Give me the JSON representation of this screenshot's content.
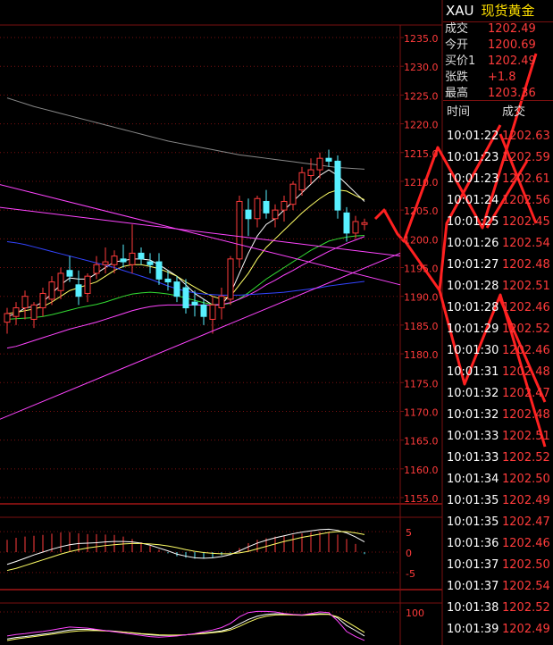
{
  "header": {
    "symbol": "XAU",
    "name": "现货黄金"
  },
  "quote": [
    {
      "label": "成交",
      "value": "1202.49"
    },
    {
      "label": "今开",
      "value": "1200.69"
    },
    {
      "label": "买价1",
      "value": "1202.49"
    },
    {
      "label": "张跌",
      "value": "+1.8"
    },
    {
      "label": "最高",
      "value": "1203.36"
    }
  ],
  "ticks_header": {
    "time": "时间",
    "price": "成交"
  },
  "ticks": [
    {
      "time": "10:01:22",
      "price": "1202.63"
    },
    {
      "time": "10:01:23",
      "price": "1202.59"
    },
    {
      "time": "10:01:23",
      "price": "1202.61"
    },
    {
      "time": "10:01:24",
      "price": "1202.56"
    },
    {
      "time": "10:01:25",
      "price": "1202.45"
    },
    {
      "time": "10:01:26",
      "price": "1202.54"
    },
    {
      "time": "10:01:27",
      "price": "1202.48"
    },
    {
      "time": "10:01:28",
      "price": "1202.51"
    },
    {
      "time": "10:01:28",
      "price": "1202.46"
    },
    {
      "time": "10:01:29",
      "price": "1202.52"
    },
    {
      "time": "10:01:30",
      "price": "1202.46"
    },
    {
      "time": "10:01:31",
      "price": "1202.48"
    },
    {
      "time": "10:01:32",
      "price": "1202.47"
    },
    {
      "time": "10:01:32",
      "price": "1202.48"
    },
    {
      "time": "10:01:33",
      "price": "1202.51"
    },
    {
      "time": "10:01:33",
      "price": "1202.52"
    },
    {
      "time": "10:01:34",
      "price": "1202.50"
    },
    {
      "time": "10:01:35",
      "price": "1202.49"
    },
    {
      "time": "10:01:35",
      "price": "1202.47"
    },
    {
      "time": "10:01:36",
      "price": "1202.46"
    },
    {
      "time": "10:01:37",
      "price": "1202.50"
    },
    {
      "time": "10:01:37",
      "price": "1202.54"
    },
    {
      "time": "10:01:38",
      "price": "1202.52"
    },
    {
      "time": "10:01:39",
      "price": "1202.49"
    }
  ],
  "colors": {
    "up": "#ff3b3b",
    "down": "#58f0ff",
    "grid": "#7a1010",
    "axis_text": "#ff3b3b"
  },
  "chart_data": [
    {
      "type": "candlestick",
      "ylim": [
        1155,
        1235
      ],
      "yticks": [
        "1235.0",
        "1230.0",
        "1225.0",
        "1220.0",
        "1215.0",
        "1210.0",
        "1205.0",
        "1200.0",
        "1195.0",
        "1190.0",
        "1185.0",
        "1180.0",
        "1175.0",
        "1170.0",
        "1165.0",
        "1160.0",
        "1155.0"
      ],
      "candles": [
        {
          "o": 1185.5,
          "h": 1188.0,
          "l": 1183.5,
          "c": 1187.0
        },
        {
          "o": 1186.5,
          "h": 1189.0,
          "l": 1185.0,
          "c": 1188.0
        },
        {
          "o": 1188.0,
          "h": 1191.0,
          "l": 1186.0,
          "c": 1190.0
        },
        {
          "o": 1186.0,
          "h": 1189.0,
          "l": 1184.5,
          "c": 1188.5
        },
        {
          "o": 1188.0,
          "h": 1191.5,
          "l": 1186.5,
          "c": 1190.5
        },
        {
          "o": 1189.5,
          "h": 1193.5,
          "l": 1188.5,
          "c": 1192.5
        },
        {
          "o": 1191.0,
          "h": 1195.0,
          "l": 1189.5,
          "c": 1194.0
        },
        {
          "o": 1194.5,
          "h": 1197.0,
          "l": 1192.5,
          "c": 1193.5
        },
        {
          "o": 1192.0,
          "h": 1194.5,
          "l": 1188.5,
          "c": 1190.0
        },
        {
          "o": 1190.5,
          "h": 1194.0,
          "l": 1189.0,
          "c": 1193.5
        },
        {
          "o": 1194.0,
          "h": 1197.0,
          "l": 1193.0,
          "c": 1195.5
        },
        {
          "o": 1195.5,
          "h": 1198.5,
          "l": 1194.0,
          "c": 1196.0
        },
        {
          "o": 1195.5,
          "h": 1198.0,
          "l": 1194.0,
          "c": 1197.0
        },
        {
          "o": 1196.5,
          "h": 1199.0,
          "l": 1195.0,
          "c": 1196.0
        },
        {
          "o": 1195.5,
          "h": 1202.5,
          "l": 1194.0,
          "c": 1197.5
        },
        {
          "o": 1197.5,
          "h": 1198.5,
          "l": 1195.5,
          "c": 1196.5
        },
        {
          "o": 1196.0,
          "h": 1197.5,
          "l": 1194.0,
          "c": 1195.5
        },
        {
          "o": 1196.0,
          "h": 1197.5,
          "l": 1192.0,
          "c": 1193.0
        },
        {
          "o": 1193.0,
          "h": 1194.5,
          "l": 1191.0,
          "c": 1192.5
        },
        {
          "o": 1192.5,
          "h": 1193.5,
          "l": 1189.0,
          "c": 1190.0
        },
        {
          "o": 1191.5,
          "h": 1193.0,
          "l": 1187.0,
          "c": 1188.0
        },
        {
          "o": 1189.0,
          "h": 1191.0,
          "l": 1186.5,
          "c": 1188.5
        },
        {
          "o": 1188.5,
          "h": 1189.5,
          "l": 1185.0,
          "c": 1186.5
        },
        {
          "o": 1186.0,
          "h": 1190.0,
          "l": 1183.5,
          "c": 1188.5
        },
        {
          "o": 1188.0,
          "h": 1191.5,
          "l": 1186.0,
          "c": 1190.0
        },
        {
          "o": 1189.5,
          "h": 1197.0,
          "l": 1188.5,
          "c": 1196.5
        },
        {
          "o": 1196.5,
          "h": 1207.5,
          "l": 1195.0,
          "c": 1206.5
        },
        {
          "o": 1205.0,
          "h": 1207.0,
          "l": 1200.5,
          "c": 1203.5
        },
        {
          "o": 1203.5,
          "h": 1207.5,
          "l": 1202.0,
          "c": 1207.0
        },
        {
          "o": 1206.5,
          "h": 1208.5,
          "l": 1203.5,
          "c": 1204.5
        },
        {
          "o": 1203.5,
          "h": 1206.0,
          "l": 1202.0,
          "c": 1205.0
        },
        {
          "o": 1205.0,
          "h": 1207.5,
          "l": 1203.0,
          "c": 1206.5
        },
        {
          "o": 1206.0,
          "h": 1210.0,
          "l": 1205.0,
          "c": 1209.5
        },
        {
          "o": 1208.5,
          "h": 1212.5,
          "l": 1207.5,
          "c": 1211.5
        },
        {
          "o": 1211.0,
          "h": 1214.0,
          "l": 1209.5,
          "c": 1212.0
        },
        {
          "o": 1212.0,
          "h": 1215.0,
          "l": 1210.5,
          "c": 1214.0
        },
        {
          "o": 1214.0,
          "h": 1215.5,
          "l": 1212.5,
          "c": 1213.5
        },
        {
          "o": 1213.5,
          "h": 1214.5,
          "l": 1203.5,
          "c": 1205.0
        },
        {
          "o": 1204.5,
          "h": 1205.5,
          "l": 1199.5,
          "c": 1201.0
        },
        {
          "o": 1201.0,
          "h": 1204.0,
          "l": 1200.0,
          "c": 1203.0
        },
        {
          "o": 1202.5,
          "h": 1203.5,
          "l": 1201.5,
          "c": 1202.8
        }
      ],
      "lines": [
        {
          "color": "#ffffff",
          "values": [
            1186.5,
            1187,
            1188,
            1188.2,
            1189,
            1190.5,
            1192,
            1193.2,
            1193,
            1193,
            1194,
            1195,
            1196,
            1196.2,
            1196.5,
            1196.5,
            1196.3,
            1195.5,
            1194.5,
            1193.5,
            1192,
            1190.5,
            1189.5,
            1188.5,
            1188.5,
            1190.5,
            1194,
            1197.5,
            1200.5,
            1202.5,
            1203.5,
            1205,
            1206.5,
            1208,
            1209.5,
            1211,
            1212,
            1211,
            1209.5,
            1208,
            1206.5
          ]
        },
        {
          "color": "#ffff66",
          "values": [
            1187,
            1187.2,
            1187.5,
            1187.8,
            1188.2,
            1189,
            1190,
            1191,
            1191.5,
            1192,
            1192.5,
            1193.5,
            1194.5,
            1195.2,
            1195.5,
            1195.5,
            1195.2,
            1194.8,
            1194.2,
            1193.5,
            1192.5,
            1191.6,
            1190.7,
            1190,
            1189.5,
            1190,
            1192,
            1194,
            1196.5,
            1198.5,
            1200,
            1201.5,
            1203,
            1204.5,
            1205.8,
            1207,
            1208,
            1208.5,
            1208.3,
            1207.5,
            1206.8
          ]
        },
        {
          "color": "#33dd33",
          "values": [
            1186,
            1186.1,
            1186.2,
            1186.3,
            1186.5,
            1186.8,
            1187.2,
            1187.6,
            1188,
            1188.3,
            1188.6,
            1189,
            1189.5,
            1190,
            1190.4,
            1190.6,
            1190.7,
            1190.6,
            1190.4,
            1190.1,
            1189.7,
            1189.3,
            1188.9,
            1188.6,
            1188.5,
            1188.8,
            1189.6,
            1190.6,
            1191.8,
            1193,
            1194,
            1195,
            1196,
            1197,
            1198,
            1198.8,
            1199.6,
            1200,
            1200.3,
            1200.5,
            1200.6
          ]
        },
        {
          "color": "#ff44ff",
          "values": [
            1181,
            1181.3,
            1181.8,
            1182.3,
            1182.8,
            1183.3,
            1183.8,
            1184.3,
            1184.7,
            1185.1,
            1185.5,
            1186,
            1186.5,
            1187,
            1187.5,
            1187.9,
            1188.2,
            1188.4,
            1188.5,
            1188.5,
            1188.5,
            1188.5,
            1188.5,
            1188.5,
            1188.6,
            1188.9,
            1189.5,
            1190.2,
            1191,
            1192,
            1192.8,
            1193.7,
            1194.5,
            1195.4,
            1196.2,
            1197,
            1197.8,
            1198.5,
            1199.2,
            1199.8,
            1200.4
          ]
        },
        {
          "color": "#3344ff",
          "values": [
            1199.5,
            1199.3,
            1199,
            1198.6,
            1198.2,
            1197.8,
            1197.4,
            1197,
            1196.6,
            1196.2,
            1195.8,
            1195.4,
            1195,
            1194.5,
            1194,
            1193.5,
            1193,
            1192.4,
            1191.8,
            1191.3,
            1190.9,
            1190.6,
            1190.4,
            1190.3,
            1190.2,
            1190.2,
            1190.2,
            1190.3,
            1190.4,
            1190.5,
            1190.6,
            1190.7,
            1190.9,
            1191.1,
            1191.3,
            1191.5,
            1191.8,
            1192,
            1192.2,
            1192.4,
            1192.6
          ]
        },
        {
          "color": "#888888",
          "values": [
            1224.5,
            1224,
            1223.5,
            1223,
            1222.6,
            1222.2,
            1221.8,
            1221.4,
            1221,
            1220.6,
            1220.2,
            1219.8,
            1219.4,
            1219,
            1218.6,
            1218.2,
            1217.8,
            1217.4,
            1217,
            1216.7,
            1216.4,
            1216.1,
            1215.8,
            1215.5,
            1215.2,
            1214.9,
            1214.6,
            1214.4,
            1214.2,
            1214,
            1213.8,
            1213.6,
            1213.4,
            1213.2,
            1213,
            1212.8,
            1212.6,
            1212.4,
            1212.3,
            1212.2,
            1212.1
          ]
        }
      ]
    },
    {
      "type": "bar",
      "name": "macd",
      "ylim": [
        -7,
        7
      ],
      "yticks": [
        "5",
        "0",
        "-5"
      ],
      "values": [
        3,
        3.5,
        3.8,
        4,
        4.2,
        4.5,
        4.8,
        4.9,
        4.6,
        4.4,
        4.4,
        4.3,
        4.2,
        3.8,
        3.2,
        2.4,
        1.5,
        0.6,
        -0.3,
        -1,
        -1.4,
        -1.6,
        -1.6,
        -1.3,
        -0.8,
        -0.2,
        1,
        2.2,
        3,
        3.4,
        3.8,
        4,
        4.3,
        4.6,
        4.8,
        5,
        4.8,
        4.3,
        3.2,
        2,
        -0.5
      ],
      "lines": [
        {
          "color": "#ffffff",
          "values": [
            -3,
            -2.3,
            -1.5,
            -0.7,
            0,
            0.7,
            1.3,
            1.8,
            2.1,
            2.2,
            2.3,
            2.5,
            2.6,
            2.6,
            2.5,
            2.2,
            1.7,
            1,
            0.3,
            -0.5,
            -1,
            -1.4,
            -1.5,
            -1.4,
            -1.1,
            -0.6,
            0.3,
            1.3,
            2.2,
            2.9,
            3.5,
            4,
            4.5,
            4.9,
            5.2,
            5.5,
            5.6,
            5.3,
            4.7,
            3.7,
            2.5
          ]
        },
        {
          "color": "#ffff66",
          "values": [
            -4.5,
            -4,
            -3.3,
            -2.6,
            -1.9,
            -1.2,
            -0.5,
            0.1,
            0.6,
            1,
            1.3,
            1.6,
            1.8,
            2,
            2.1,
            2.1,
            2,
            1.8,
            1.5,
            1.1,
            0.6,
            0.2,
            -0.1,
            -0.3,
            -0.4,
            -0.4,
            -0.2,
            0.2,
            0.8,
            1.4,
            2,
            2.6,
            3.1,
            3.6,
            4,
            4.4,
            4.8,
            5,
            5,
            4.7,
            4.3
          ]
        }
      ]
    },
    {
      "type": "line",
      "name": "kdj",
      "ylim": [
        -10,
        115
      ],
      "yticks": [
        "100"
      ],
      "lines": [
        {
          "color": "#ffffff",
          "values": [
            10,
            15,
            18,
            22,
            26,
            30,
            35,
            40,
            42,
            42,
            40,
            38,
            36,
            33,
            30,
            27,
            24,
            22,
            22,
            22,
            24,
            27,
            30,
            33,
            37,
            45,
            60,
            75,
            86,
            92,
            94,
            93,
            91,
            90,
            92,
            94,
            93,
            80,
            55,
            38,
            20
          ]
        },
        {
          "color": "#ffff66",
          "values": [
            5,
            10,
            14,
            18,
            22,
            26,
            30,
            34,
            37,
            38,
            38,
            37,
            35,
            33,
            31,
            28,
            26,
            24,
            23,
            23,
            24,
            26,
            28,
            31,
            34,
            40,
            52,
            66,
            78,
            86,
            90,
            91,
            90,
            89,
            90,
            92,
            92,
            84,
            68,
            50,
            32
          ]
        },
        {
          "color": "#ff44ff",
          "values": [
            20,
            25,
            28,
            32,
            35,
            40,
            45,
            50,
            48,
            46,
            42,
            38,
            34,
            30,
            26,
            22,
            18,
            16,
            18,
            20,
            24,
            28,
            34,
            40,
            48,
            62,
            84,
            98,
            102,
            102,
            100,
            95,
            92,
            90,
            95,
            100,
            98,
            70,
            35,
            18,
            5
          ]
        }
      ]
    }
  ]
}
